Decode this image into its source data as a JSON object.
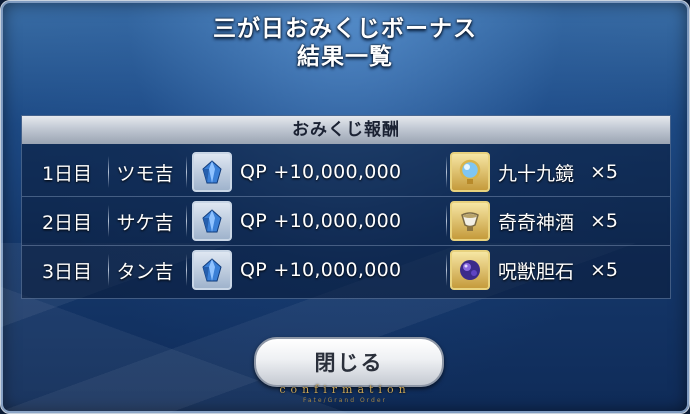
{
  "dialog": {
    "title_line1": "三が日おみくじボーナス",
    "title_line2": "結果一覧"
  },
  "rewards": {
    "header": "おみくじ報酬",
    "rows": [
      {
        "day": "1日目",
        "fortune": "ツモ吉",
        "qp": "QP +10,000,000",
        "item": "九十九鏡",
        "qty": "×5",
        "item_icon": "mirror-icon"
      },
      {
        "day": "2日目",
        "fortune": "サケ吉",
        "qp": "QP +10,000,000",
        "item": "奇奇神酒",
        "qty": "×5",
        "item_icon": "sake-cup-icon"
      },
      {
        "day": "3日目",
        "fortune": "タン吉",
        "qp": "QP +10,000,000",
        "item": "呪獣胆石",
        "qty": "×5",
        "item_icon": "gallstone-icon"
      }
    ]
  },
  "footer": {
    "close_label": "閉じる",
    "confirm_text": "confirmation",
    "confirm_sub": "Fate/Grand Order"
  },
  "colors": {
    "background": "#15386b",
    "header_band": "#c1c8d3",
    "button": "#eef0f3",
    "confirm_gold": "#c9a557"
  }
}
